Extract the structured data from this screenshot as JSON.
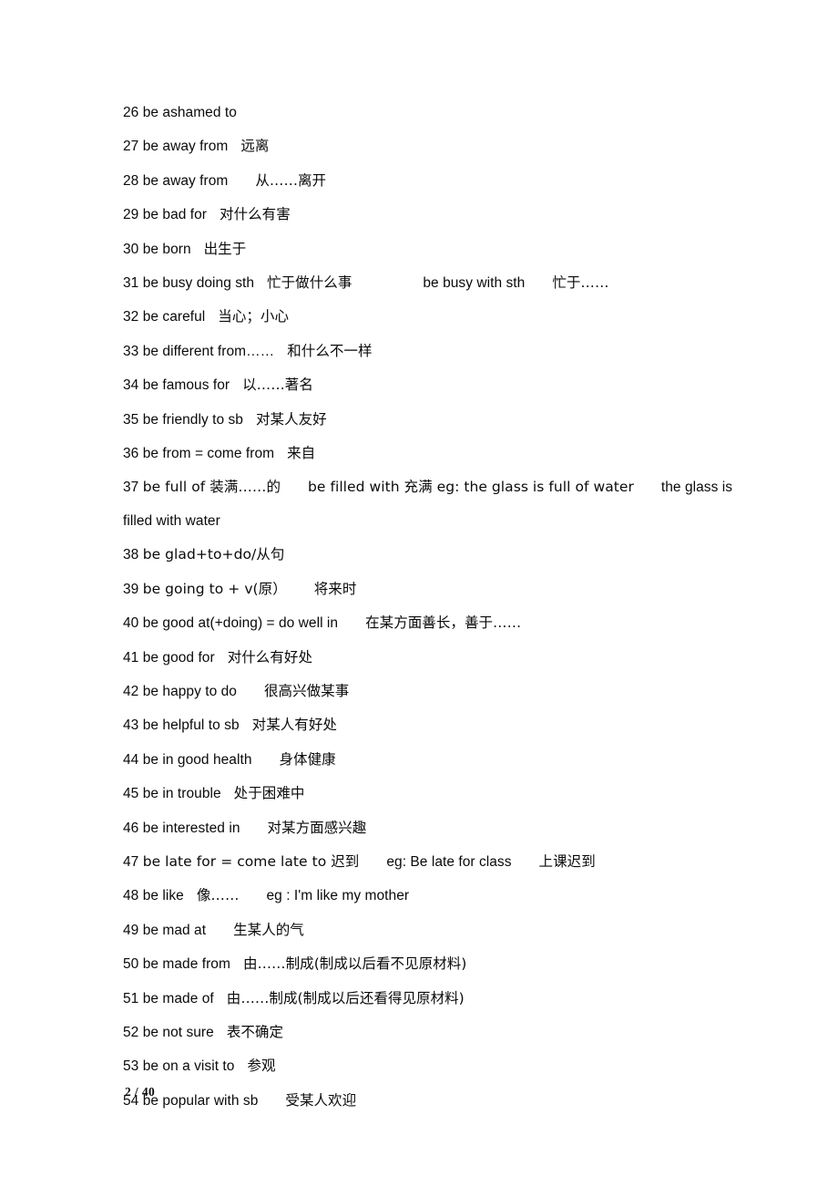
{
  "page": {
    "footer": "2 / 40",
    "background_color": "#ffffff",
    "text_color": "#0a0a0a"
  },
  "entries": [
    {
      "num": "26",
      "phrase": "be ashamed to",
      "gap1": "",
      "meaning": "",
      "gap2": "",
      "extra": "",
      "gap3": "",
      "extra_meaning": ""
    },
    {
      "num": "27",
      "phrase": "be away from",
      "gap1": "gap-sm",
      "meaning": "远离",
      "gap2": "",
      "extra": "",
      "gap3": "",
      "extra_meaning": ""
    },
    {
      "num": "28",
      "phrase": "be away from",
      "gap1": "gap-md",
      "meaning": "从……离开",
      "gap2": "",
      "extra": "",
      "gap3": "",
      "extra_meaning": ""
    },
    {
      "num": "29",
      "phrase": "be bad for",
      "gap1": "gap-sm",
      "meaning": "对什么有害",
      "gap2": "",
      "extra": "",
      "gap3": "",
      "extra_meaning": ""
    },
    {
      "num": "30",
      "phrase": "be born",
      "gap1": "gap-sm",
      "meaning": "出生于",
      "gap2": "",
      "extra": "",
      "gap3": "",
      "extra_meaning": ""
    },
    {
      "num": "31",
      "phrase": "be busy doing sth",
      "gap1": "gap-sm",
      "meaning": "忙于做什么事",
      "gap2": "gap-xl",
      "extra": "be busy with sth",
      "gap3": "gap-md",
      "extra_meaning": "忙于……"
    },
    {
      "num": "32",
      "phrase": "be careful",
      "gap1": "gap-sm",
      "meaning": "当心；小心",
      "gap2": "",
      "extra": "",
      "gap3": "",
      "extra_meaning": ""
    },
    {
      "num": "33",
      "phrase": "be different from……",
      "gap1": "gap-sm",
      "meaning": "和什么不一样",
      "gap2": "",
      "extra": "",
      "gap3": "",
      "extra_meaning": ""
    },
    {
      "num": "34",
      "phrase": "be famous for",
      "gap1": "gap-sm",
      "meaning": "以……著名",
      "gap2": "",
      "extra": "",
      "gap3": "",
      "extra_meaning": ""
    },
    {
      "num": "35",
      "phrase": "be friendly to sb",
      "gap1": "gap-sm",
      "meaning": "对某人友好",
      "gap2": "",
      "extra": "",
      "gap3": "",
      "extra_meaning": ""
    },
    {
      "num": "36",
      "phrase": "be from = come from",
      "gap1": "gap-sm",
      "meaning": "来自",
      "gap2": "",
      "extra": "",
      "gap3": "",
      "extra_meaning": ""
    },
    {
      "num": "37",
      "phrase": "be full of 装满……的",
      "gap1": "gap-md",
      "meaning": "be filled with 充满 eg: the glass is full of water",
      "gap2": "gap-md",
      "extra": "the glass is filled with water",
      "gap3": "",
      "extra_meaning": ""
    },
    {
      "num": "38",
      "phrase": "be glad+to+do/从句",
      "gap1": "",
      "meaning": "",
      "gap2": "",
      "extra": "",
      "gap3": "",
      "extra_meaning": ""
    },
    {
      "num": "39",
      "phrase": "be going to + v(原）",
      "gap1": "gap-md",
      "meaning": "将来时",
      "gap2": "",
      "extra": "",
      "gap3": "",
      "extra_meaning": ""
    },
    {
      "num": "40",
      "phrase": "be good at(+doing) = do well in",
      "gap1": "gap-md",
      "meaning": "在某方面善长，善于……",
      "gap2": "",
      "extra": "",
      "gap3": "",
      "extra_meaning": ""
    },
    {
      "num": "41",
      "phrase": "be good for",
      "gap1": "gap-sm",
      "meaning": "对什么有好处",
      "gap2": "",
      "extra": "",
      "gap3": "",
      "extra_meaning": ""
    },
    {
      "num": "42",
      "phrase": "be happy to do",
      "gap1": "gap-md",
      "meaning": "很高兴做某事",
      "gap2": "",
      "extra": "",
      "gap3": "",
      "extra_meaning": ""
    },
    {
      "num": "43",
      "phrase": "be helpful to sb",
      "gap1": "gap-sm",
      "meaning": "对某人有好处",
      "gap2": "",
      "extra": "",
      "gap3": "",
      "extra_meaning": ""
    },
    {
      "num": "44",
      "phrase": "be in good health",
      "gap1": "gap-md",
      "meaning": "身体健康",
      "gap2": "",
      "extra": "",
      "gap3": "",
      "extra_meaning": ""
    },
    {
      "num": "45",
      "phrase": "be in trouble",
      "gap1": "gap-sm",
      "meaning": "处于困难中",
      "gap2": "",
      "extra": "",
      "gap3": "",
      "extra_meaning": ""
    },
    {
      "num": "46",
      "phrase": "be interested in",
      "gap1": "gap-md",
      "meaning": "对某方面感兴趣",
      "gap2": "",
      "extra": "",
      "gap3": "",
      "extra_meaning": ""
    },
    {
      "num": "47",
      "phrase": "be late for = come late to 迟到",
      "gap1": "gap-md",
      "meaning": "eg: Be late for class",
      "gap2": "gap-md",
      "extra": "上课迟到",
      "gap3": "",
      "extra_meaning": ""
    },
    {
      "num": "48",
      "phrase": "be like",
      "gap1": "gap-sm",
      "meaning": "像……",
      "gap2": "gap-md",
      "extra": "eg : I'm like my mother",
      "gap3": "",
      "extra_meaning": ""
    },
    {
      "num": "49",
      "phrase": "be mad at",
      "gap1": "gap-md",
      "meaning": "生某人的气",
      "gap2": "",
      "extra": "",
      "gap3": "",
      "extra_meaning": ""
    },
    {
      "num": "50",
      "phrase": "be made from",
      "gap1": "gap-sm",
      "meaning": "由……制成(制成以后看不见原材料)",
      "gap2": "",
      "extra": "",
      "gap3": "",
      "extra_meaning": ""
    },
    {
      "num": "51",
      "phrase": "be made of",
      "gap1": "gap-sm",
      "meaning": "由……制成(制成以后还看得见原材料)",
      "gap2": "",
      "extra": "",
      "gap3": "",
      "extra_meaning": ""
    },
    {
      "num": "52",
      "phrase": "be not sure",
      "gap1": "gap-sm",
      "meaning": "表不确定",
      "gap2": "",
      "extra": "",
      "gap3": "",
      "extra_meaning": ""
    },
    {
      "num": "53",
      "phrase": "be on a visit to",
      "gap1": "gap-sm",
      "meaning": "参观",
      "gap2": "",
      "extra": "",
      "gap3": "",
      "extra_meaning": ""
    },
    {
      "num": "54",
      "phrase": "be popular with sb",
      "gap1": "gap-md",
      "meaning": "受某人欢迎",
      "gap2": "",
      "extra": "",
      "gap3": "",
      "extra_meaning": ""
    }
  ]
}
